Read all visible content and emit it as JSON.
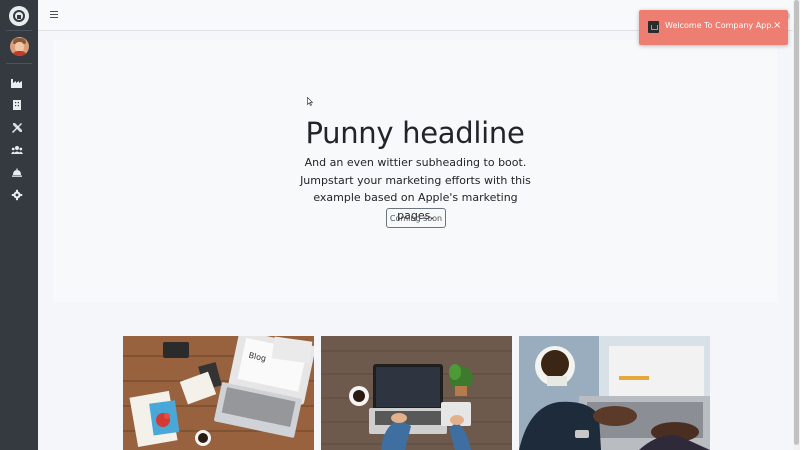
{
  "sidebar": {
    "brand_icon": "app-logo-icon",
    "avatar": "user-avatar",
    "items": [
      {
        "icon": "industry-icon"
      },
      {
        "icon": "building-icon"
      },
      {
        "icon": "tools-icon"
      },
      {
        "icon": "users-icon"
      },
      {
        "icon": "concierge-bell-icon"
      },
      {
        "icon": "gear-icon"
      }
    ]
  },
  "topnav": {
    "menu_icon": "hamburger-icon"
  },
  "hero": {
    "title": "Punny headline",
    "subtitle": "And an even wittier subheading to boot. Jumpstart your marketing efforts with this example based on Apple's marketing pages.",
    "button_label": "Coming soon"
  },
  "toast": {
    "message": "Welcome To Company App.",
    "close_label": "×",
    "color": "#ee7e72"
  },
  "cards": [
    {
      "image": "desk-with-blog-laptop-photo"
    },
    {
      "image": "laptop-coffee-plant-photo"
    },
    {
      "image": "typing-on-laptop-coffee-photo"
    }
  ],
  "colors": {
    "sidebar": "#343a40",
    "background": "#f4f6f9",
    "hero": "#f8f9fa",
    "text": "#212529"
  }
}
